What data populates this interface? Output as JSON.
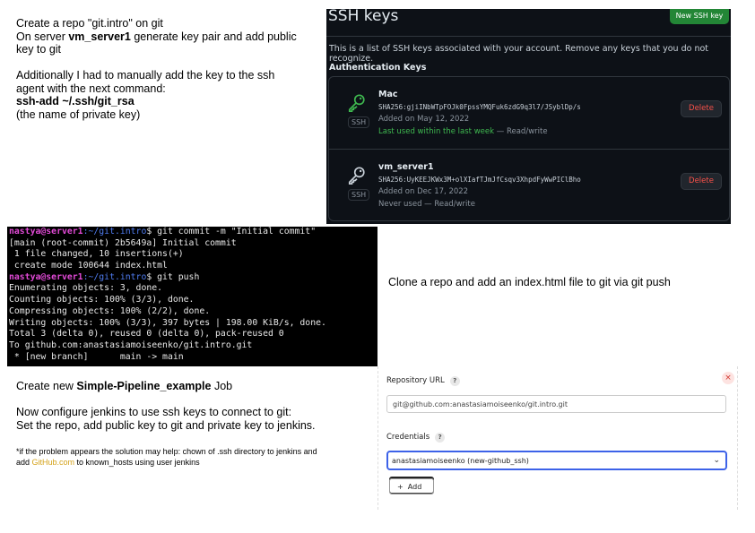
{
  "notes_top": {
    "line1": "Create a repo \"git.intro\" on git",
    "line2_pre": "On server ",
    "line2_bold": "vm_server1",
    "line2_post": " generate key pair and add public",
    "line3": "key to git",
    "line4": "Additionally I had to manually add the key to the ssh",
    "line5": "agent with the next command:",
    "line6_bold": "ssh-add ~/.ssh/git_rsa",
    "line7": "(the name of private key)"
  },
  "ssh_panel": {
    "title": "SSH keys",
    "new_button": "New SSH key",
    "description": "This is a list of SSH keys associated with your account. Remove any keys that you do not recognize.",
    "section": "Authentication Keys",
    "keys": [
      {
        "name": "Mac",
        "fingerprint": "SHA256:gjiINbWTpFOJk0FpssYMQFuk6zdG9q3l7/JSyblDp/s",
        "added": "Added on May 12, 2022",
        "used_green": "Last used within the last week",
        "used_rest": " — Read/write",
        "tag": "SSH",
        "delete": "Delete",
        "icon_color": "#3fb950"
      },
      {
        "name": "vm_server1",
        "fingerprint": "SHA256:UyKEEJKWx3M+olXIafTJmJfCsqv3XhpdFyWwPIClBho",
        "added": "Added on Dec 17, 2022",
        "used_green": "",
        "used_rest": "Never used — Read/write",
        "tag": "SSH",
        "delete": "Delete",
        "icon_color": "#c9d1d9"
      }
    ]
  },
  "terminal": {
    "user": "nastya@server1",
    "path": ":~/git.intro",
    "cmd1": "$ git commit -m \"Initial commit\"",
    "out1": [
      "[main (root-commit) 2b5649a] Initial commit",
      " 1 file changed, 10 insertions(+)",
      " create mode 100644 index.html"
    ],
    "cmd2": "$ git push",
    "out2": [
      "Enumerating objects: 3, done.",
      "Counting objects: 100% (3/3), done.",
      "Compressing objects: 100% (2/2), done.",
      "Writing objects: 100% (3/3), 397 bytes | 198.00 KiB/s, done.",
      "Total 3 (delta 0), reused 0 (delta 0), pack-reused 0",
      "To github.com:anastasiamoiseenko/git.intro.git",
      " * [new branch]      main -> main"
    ]
  },
  "clone_note": "Clone a repo and add an index.html file to git via git push",
  "notes_bottom": {
    "line1_pre": "Create new ",
    "line1_bold": "Simple-Pipeline_example",
    "line1_post": " Job",
    "line2": "Now configure jenkins to use ssh keys to connect to git:",
    "line3": "Set the repo, add public key to git and private key to jenkins.",
    "small1": "*if the problem appears the solution may help: chown of .ssh directory to jenkins and",
    "small2_pre": "add ",
    "small2_link": "GitHub.com",
    "small2_post": " to known_hosts using user jenkins"
  },
  "jenkins": {
    "repo_label": "Repository URL",
    "repo_value": "git@github.com:anastasiamoiseenko/git.intro.git",
    "cred_label": "Credentials",
    "cred_value": "anastasiamoiseenko (new-github_ssh)",
    "help": "?",
    "add_label": "Add",
    "add_plus": "+",
    "close": "×",
    "chevron": "⌄"
  }
}
